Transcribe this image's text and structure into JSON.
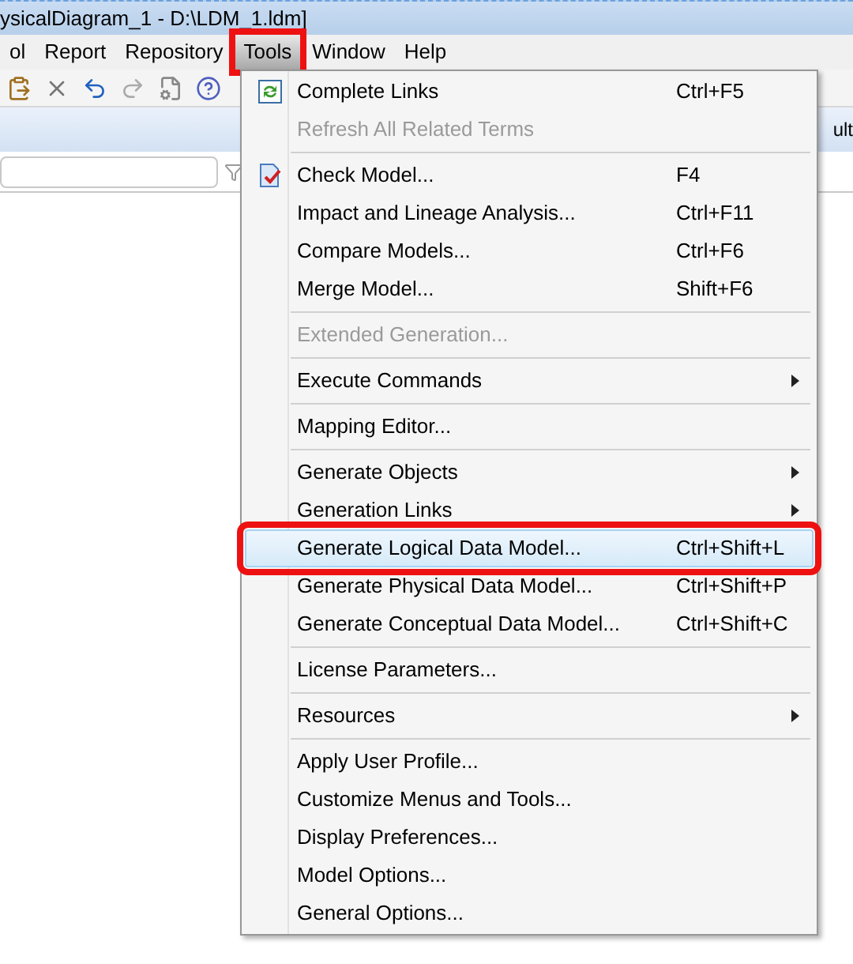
{
  "window": {
    "title": "ysicalDiagram_1 - D:\\LDM_1.ldm]"
  },
  "menubar": [
    {
      "label": "ol",
      "selected": false
    },
    {
      "label": "Report",
      "selected": false
    },
    {
      "label": "Repository",
      "selected": false
    },
    {
      "label": "Tools",
      "selected": true
    },
    {
      "label": "Window",
      "selected": false
    },
    {
      "label": "Help",
      "selected": false
    }
  ],
  "tab_strip": {
    "tab_text": "ult"
  },
  "menu": {
    "groups": [
      [
        {
          "label": "Complete Links",
          "shortcut": "Ctrl+F5",
          "disabled": false,
          "submenu": false,
          "highlighted": false
        },
        {
          "label": "Refresh All Related Terms",
          "disabled": true,
          "submenu": false,
          "highlighted": false
        }
      ],
      [
        {
          "label": "Check Model...",
          "shortcut": "F4",
          "disabled": false,
          "submenu": false,
          "highlighted": false
        },
        {
          "label": "Impact and Lineage Analysis...",
          "shortcut": "Ctrl+F11",
          "disabled": false,
          "submenu": false,
          "highlighted": false
        },
        {
          "label": "Compare Models...",
          "shortcut": "Ctrl+F6",
          "disabled": false,
          "submenu": false,
          "highlighted": false
        },
        {
          "label": "Merge Model...",
          "shortcut": "Shift+F6",
          "disabled": false,
          "submenu": false,
          "highlighted": false
        }
      ],
      [
        {
          "label": "Extended Generation...",
          "disabled": true,
          "submenu": false,
          "highlighted": false
        }
      ],
      [
        {
          "label": "Execute Commands",
          "disabled": false,
          "submenu": true,
          "highlighted": false
        }
      ],
      [
        {
          "label": "Mapping Editor...",
          "disabled": false,
          "submenu": false,
          "highlighted": false
        }
      ],
      [
        {
          "label": "Generate Objects",
          "disabled": false,
          "submenu": true,
          "highlighted": false
        },
        {
          "label": "Generation Links",
          "disabled": false,
          "submenu": true,
          "highlighted": false
        },
        {
          "label": "Generate Logical Data Model...",
          "shortcut": "Ctrl+Shift+L",
          "disabled": false,
          "submenu": false,
          "highlighted": true
        },
        {
          "label": "Generate Physical Data Model...",
          "shortcut": "Ctrl+Shift+P",
          "disabled": false,
          "submenu": false,
          "highlighted": false
        },
        {
          "label": "Generate Conceptual Data Model...",
          "shortcut": "Ctrl+Shift+C",
          "disabled": false,
          "submenu": false,
          "highlighted": false
        }
      ],
      [
        {
          "label": "License Parameters...",
          "disabled": false,
          "submenu": false,
          "highlighted": false
        }
      ],
      [
        {
          "label": "Resources",
          "disabled": false,
          "submenu": true,
          "highlighted": false
        }
      ],
      [
        {
          "label": "Apply User Profile...",
          "disabled": false,
          "submenu": false,
          "highlighted": false
        },
        {
          "label": "Customize Menus and Tools...",
          "disabled": false,
          "submenu": false,
          "highlighted": false
        },
        {
          "label": "Display Preferences...",
          "disabled": false,
          "submenu": false,
          "highlighted": false
        },
        {
          "label": "Model Options...",
          "disabled": false,
          "submenu": false,
          "highlighted": false
        },
        {
          "label": "General Options...",
          "disabled": false,
          "submenu": false,
          "highlighted": false
        }
      ]
    ]
  }
}
